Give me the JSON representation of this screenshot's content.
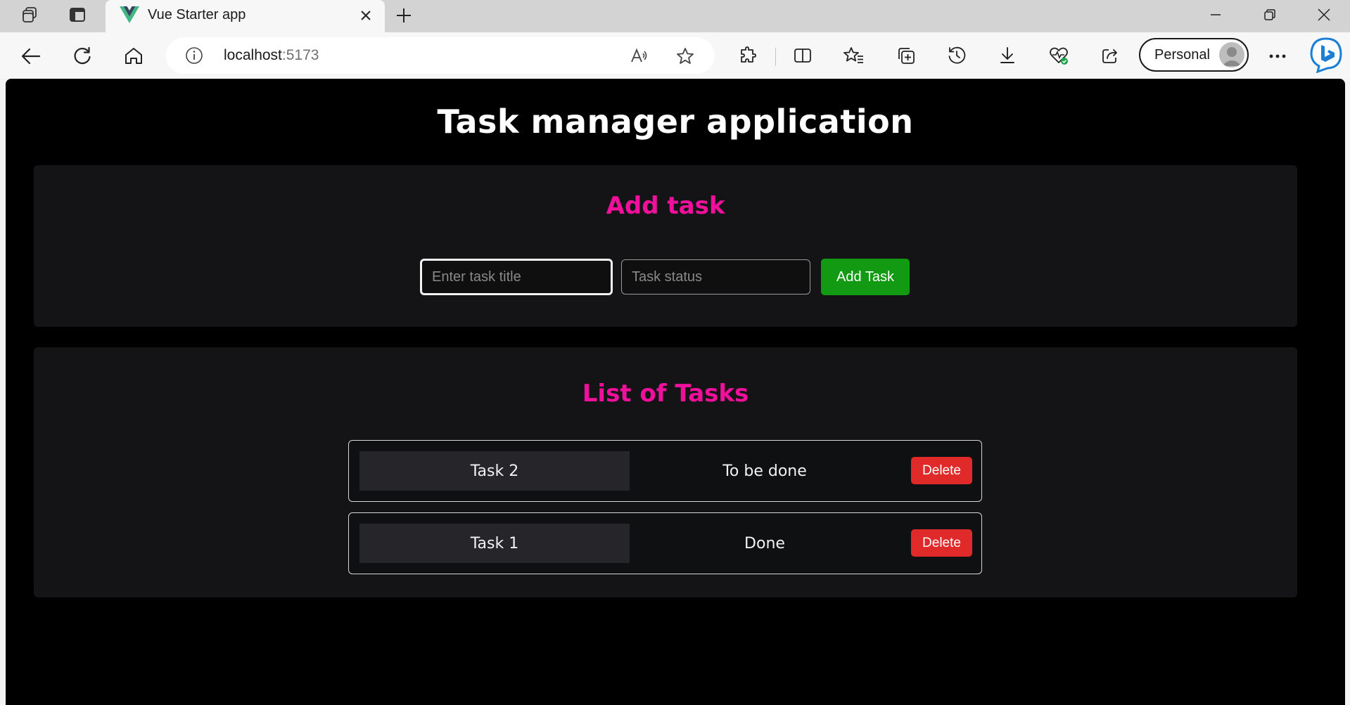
{
  "browser": {
    "tab": {
      "title": "Vue Starter app",
      "favicon": "vue-logo-icon"
    },
    "address": {
      "host": "localhost",
      "port": ":5173"
    },
    "profile": {
      "label": "Personal"
    }
  },
  "app": {
    "title": "Task manager application",
    "add_section": {
      "heading": "Add task",
      "title_placeholder": "Enter task title",
      "title_value": "",
      "status_placeholder": "Task status",
      "status_value": "",
      "submit_label": "Add Task"
    },
    "list_section": {
      "heading": "List of Tasks",
      "tasks": [
        {
          "title": "Task 2",
          "status": "To be done",
          "delete_label": "Delete"
        },
        {
          "title": "Task 1",
          "status": "Done",
          "delete_label": "Delete"
        }
      ]
    }
  },
  "colors": {
    "accent": "#f0109b",
    "add_button": "#119a12",
    "delete_button": "#e02a2a",
    "background": "#000000",
    "panel": "#141416"
  }
}
